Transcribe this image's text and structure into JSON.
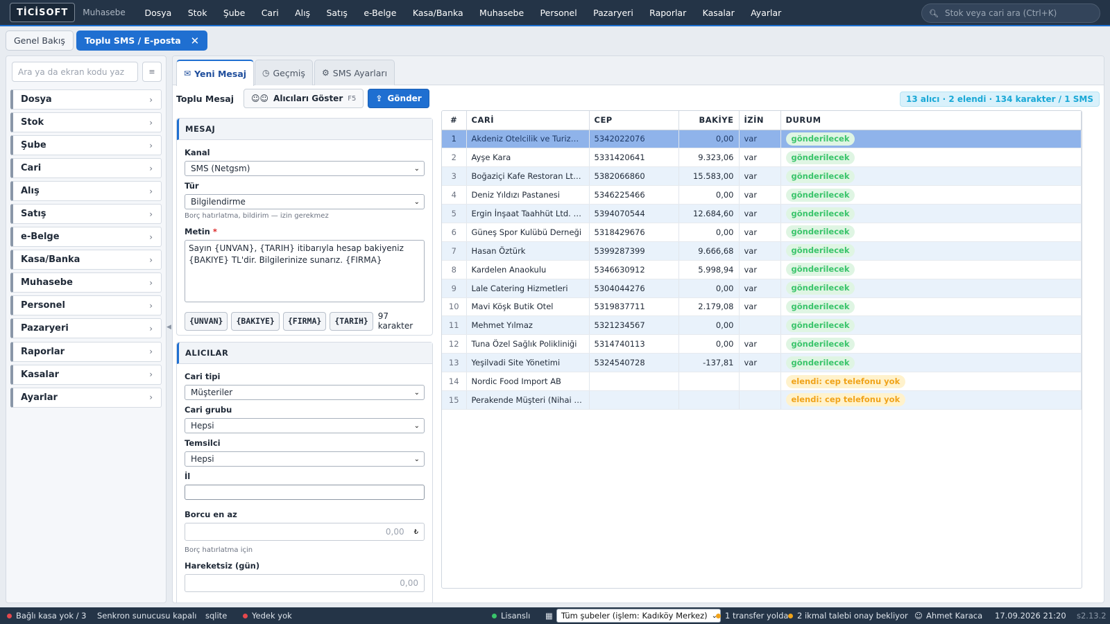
{
  "app": {
    "logo": "TİCİSOFT",
    "module": "Muhasebe"
  },
  "topmenu": [
    "Dosya",
    "Stok",
    "Şube",
    "Cari",
    "Alış",
    "Satış",
    "e-Belge",
    "Kasa/Banka",
    "Muhasebe",
    "Personel",
    "Pazaryeri",
    "Raporlar",
    "Kasalar",
    "Ayarlar"
  ],
  "search": {
    "placeholder": "Stok veya cari ara (Ctrl+K)"
  },
  "page_tabs": [
    {
      "label": "Genel Bakış"
    },
    {
      "label": "Toplu SMS / E-posta",
      "close": "✕"
    }
  ],
  "sidebar": {
    "search_placeholder": "Ara ya da ekran kodu yaz",
    "items": [
      "Dosya",
      "Stok",
      "Şube",
      "Cari",
      "Alış",
      "Satış",
      "e-Belge",
      "Kasa/Banka",
      "Muhasebe",
      "Personel",
      "Pazaryeri",
      "Raporlar",
      "Kasalar",
      "Ayarlar"
    ]
  },
  "main_tabs": [
    "Yeni Mesaj",
    "Geçmiş",
    "SMS Ayarları"
  ],
  "toolbar": {
    "title": "Toplu Mesaj",
    "show_label": "Alıcıları Göster",
    "show_key": "F5",
    "send_label": "Gönder",
    "summary": "13 alıcı · 2 elendi · 134 karakter / 1 SMS"
  },
  "message": {
    "header": "MESAJ",
    "channel_label": "Kanal",
    "channel": "SMS (Netgsm)",
    "type_label": "Tür",
    "type": "Bilgilendirme",
    "type_hint": "Borç hatırlatma, bildirim — izin gerekmez",
    "text_label": "Metin",
    "required": "*",
    "text": "Sayın {UNVAN}, {TARIH} itibarıyla hesap bakiyeniz {BAKIYE} TL'dir. Bilgilerinize sunarız. {FIRMA}",
    "tokens": [
      "{UNVAN}",
      "{BAKIYE}",
      "{FIRMA}",
      "{TARIH}"
    ],
    "char_count": "97 karakter"
  },
  "recipients": {
    "header": "ALICILAR",
    "cari_type_label": "Cari tipi",
    "cari_type": "Müşteriler",
    "cari_group_label": "Cari grubu",
    "cari_group": "Hepsi",
    "rep_label": "Temsilci",
    "rep": "Hepsi",
    "city_label": "İl",
    "city": "",
    "min_debt_label": "Borcu en az",
    "min_debt": "0,00",
    "currency": "₺",
    "min_debt_hint": "Borç hatırlatma için",
    "idle_label": "Hareketsiz (gün)",
    "idle": "0,00"
  },
  "table": {
    "headers": [
      "#",
      "CARİ",
      "CEP",
      "BAKİYE",
      "İZİN",
      "DURUM"
    ],
    "rows": [
      [
        "1",
        "Akdeniz Otelcilik ve Turizm A.Ş.",
        "5342022076",
        "0,00",
        "var",
        "gönderilecek"
      ],
      [
        "2",
        "Ayşe Kara",
        "5331420641",
        "9.323,06",
        "var",
        "gönderilecek"
      ],
      [
        "3",
        "Boğaziçi Kafe Restoran Ltd. Şti.",
        "5382066860",
        "15.583,00",
        "var",
        "gönderilecek"
      ],
      [
        "4",
        "Deniz Yıldızı Pastanesi",
        "5346225466",
        "0,00",
        "var",
        "gönderilecek"
      ],
      [
        "5",
        "Ergin İnşaat Taahhüt Ltd. Şti.",
        "5394070544",
        "12.684,60",
        "var",
        "gönderilecek"
      ],
      [
        "6",
        "Güneş Spor Kulübü Derneği",
        "5318429676",
        "0,00",
        "var",
        "gönderilecek"
      ],
      [
        "7",
        "Hasan Öztürk",
        "5399287399",
        "9.666,68",
        "var",
        "gönderilecek"
      ],
      [
        "8",
        "Kardelen Anaokulu",
        "5346630912",
        "5.998,94",
        "var",
        "gönderilecek"
      ],
      [
        "9",
        "Lale Catering Hizmetleri",
        "5304044276",
        "0,00",
        "var",
        "gönderilecek"
      ],
      [
        "10",
        "Mavi Köşk Butik Otel",
        "5319837711",
        "2.179,08",
        "var",
        "gönderilecek"
      ],
      [
        "11",
        "Mehmet Yılmaz",
        "5321234567",
        "0,00",
        "",
        "gönderilecek"
      ],
      [
        "12",
        "Tuna Özel Sağlık Polikliniği",
        "5314740113",
        "0,00",
        "var",
        "gönderilecek"
      ],
      [
        "13",
        "Yeşilvadi Site Yönetimi",
        "5324540728",
        "-137,81",
        "var",
        "gönderilecek"
      ],
      [
        "14",
        "Nordic Food Import AB",
        "",
        "",
        "",
        "elendi: cep telefonu yok"
      ],
      [
        "15",
        "Perakende Müşteri (Nihai Tüke…",
        "",
        "",
        "",
        "elendi: cep telefonu yok"
      ]
    ]
  },
  "statusbar": {
    "cash": "Bağlı kasa yok / 3",
    "sync": "Senkron sunucusu kapalı",
    "db": "sqlite",
    "backup": "Yedek yok",
    "license": "Lisanslı",
    "branch": "Tüm şubeler (işlem: Kadıköy Merkez)",
    "transfer": "1 transfer yolda",
    "requests": "2 ikmal talebi onay bekliyor",
    "user": "Ahmet Karaca",
    "datetime": "17.09.2026 21:20",
    "version": "s2.13.2"
  },
  "colors": {
    "accent": "#1f6fd1",
    "topbar": "#243447",
    "ok": "#39c46a",
    "warn": "#f0a31a",
    "danger": "#e5484d"
  }
}
